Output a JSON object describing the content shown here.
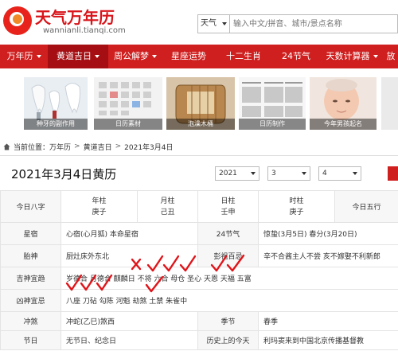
{
  "header": {
    "logo_title": "天气万年历",
    "logo_sub": "wannianli.tianqi.com",
    "search_select": "天气",
    "search_placeholder": "输入中文/拼音、城市/景点名称"
  },
  "nav": {
    "items": [
      {
        "label": "万年历",
        "dropdown": true,
        "active": false
      },
      {
        "label": "黄道吉日",
        "dropdown": true,
        "active": true
      },
      {
        "label": "周公解梦",
        "dropdown": true,
        "active": false
      },
      {
        "label": "星座运势",
        "dropdown": false,
        "active": false
      },
      {
        "label": "十二生肖",
        "dropdown": false,
        "active": false
      },
      {
        "label": "24节气",
        "dropdown": false,
        "active": false
      },
      {
        "label": "天数计算器",
        "dropdown": true,
        "active": false
      },
      {
        "label": "放",
        "dropdown": false,
        "active": false
      }
    ]
  },
  "thumbs": [
    {
      "caption": "种牙的副作用"
    },
    {
      "caption": "日历素材"
    },
    {
      "caption": "泡澡木桶"
    },
    {
      "caption": "日历制作"
    },
    {
      "caption": "今年男孩起名"
    }
  ],
  "breadcrumb": {
    "current_label": "当前位置：",
    "items": [
      "万年历",
      "黄道吉日",
      "2021年3月4日"
    ]
  },
  "title_row": {
    "title": "2021年3月4日黄历",
    "year": "2021",
    "month": "3",
    "day": "4"
  },
  "table": {
    "bazi_label": "今日八字",
    "year_pillar": {
      "label": "年柱",
      "value": "庚子"
    },
    "month_pillar": {
      "label": "月柱",
      "value": "己丑"
    },
    "day_pillar": {
      "label": "日柱",
      "value": "壬申"
    },
    "hour_pillar": {
      "label": "时柱",
      "value": "庚子"
    },
    "wuxing_label": "今日五行",
    "xingxiu_label": "星宿",
    "xingxiu_value": "心宿(心月狐) 本命星宿",
    "jieqi_label": "24节气",
    "jieqi_value": "惊蛰(3月5日) 春分(3月20日)",
    "taishen_label": "胎神",
    "taishen_value": "厨灶床外东北",
    "pengzu_label": "彭祖百忌",
    "pengzu_value": "辛不合酱主人不尝 亥不嫁娶不利新郎",
    "jishen_label": "吉神宜趋",
    "jishen_value": "岁德合 月德合 麒麟日 不将 六合 母仓 圣心 天恩 天福 五富",
    "xiongshen_label": "凶神宜忌",
    "xiongshen_value": "八座 刀砧 勾陈 河魁 劫煞 土禁 朱雀中",
    "chongsha_label": "冲煞",
    "chongsha_value": "冲蛇(乙巳)煞西",
    "season_label": "季节",
    "season_value": "春季",
    "festival_label": "节日",
    "festival_value": "无节日、纪念日",
    "history_label": "历史上的今天",
    "history_value": "利玛窦来到中国北京传播基督教"
  },
  "colors": {
    "brand_red": "#cf1f1f",
    "nav_active": "#a50f14",
    "check_red": "#e0141a"
  }
}
